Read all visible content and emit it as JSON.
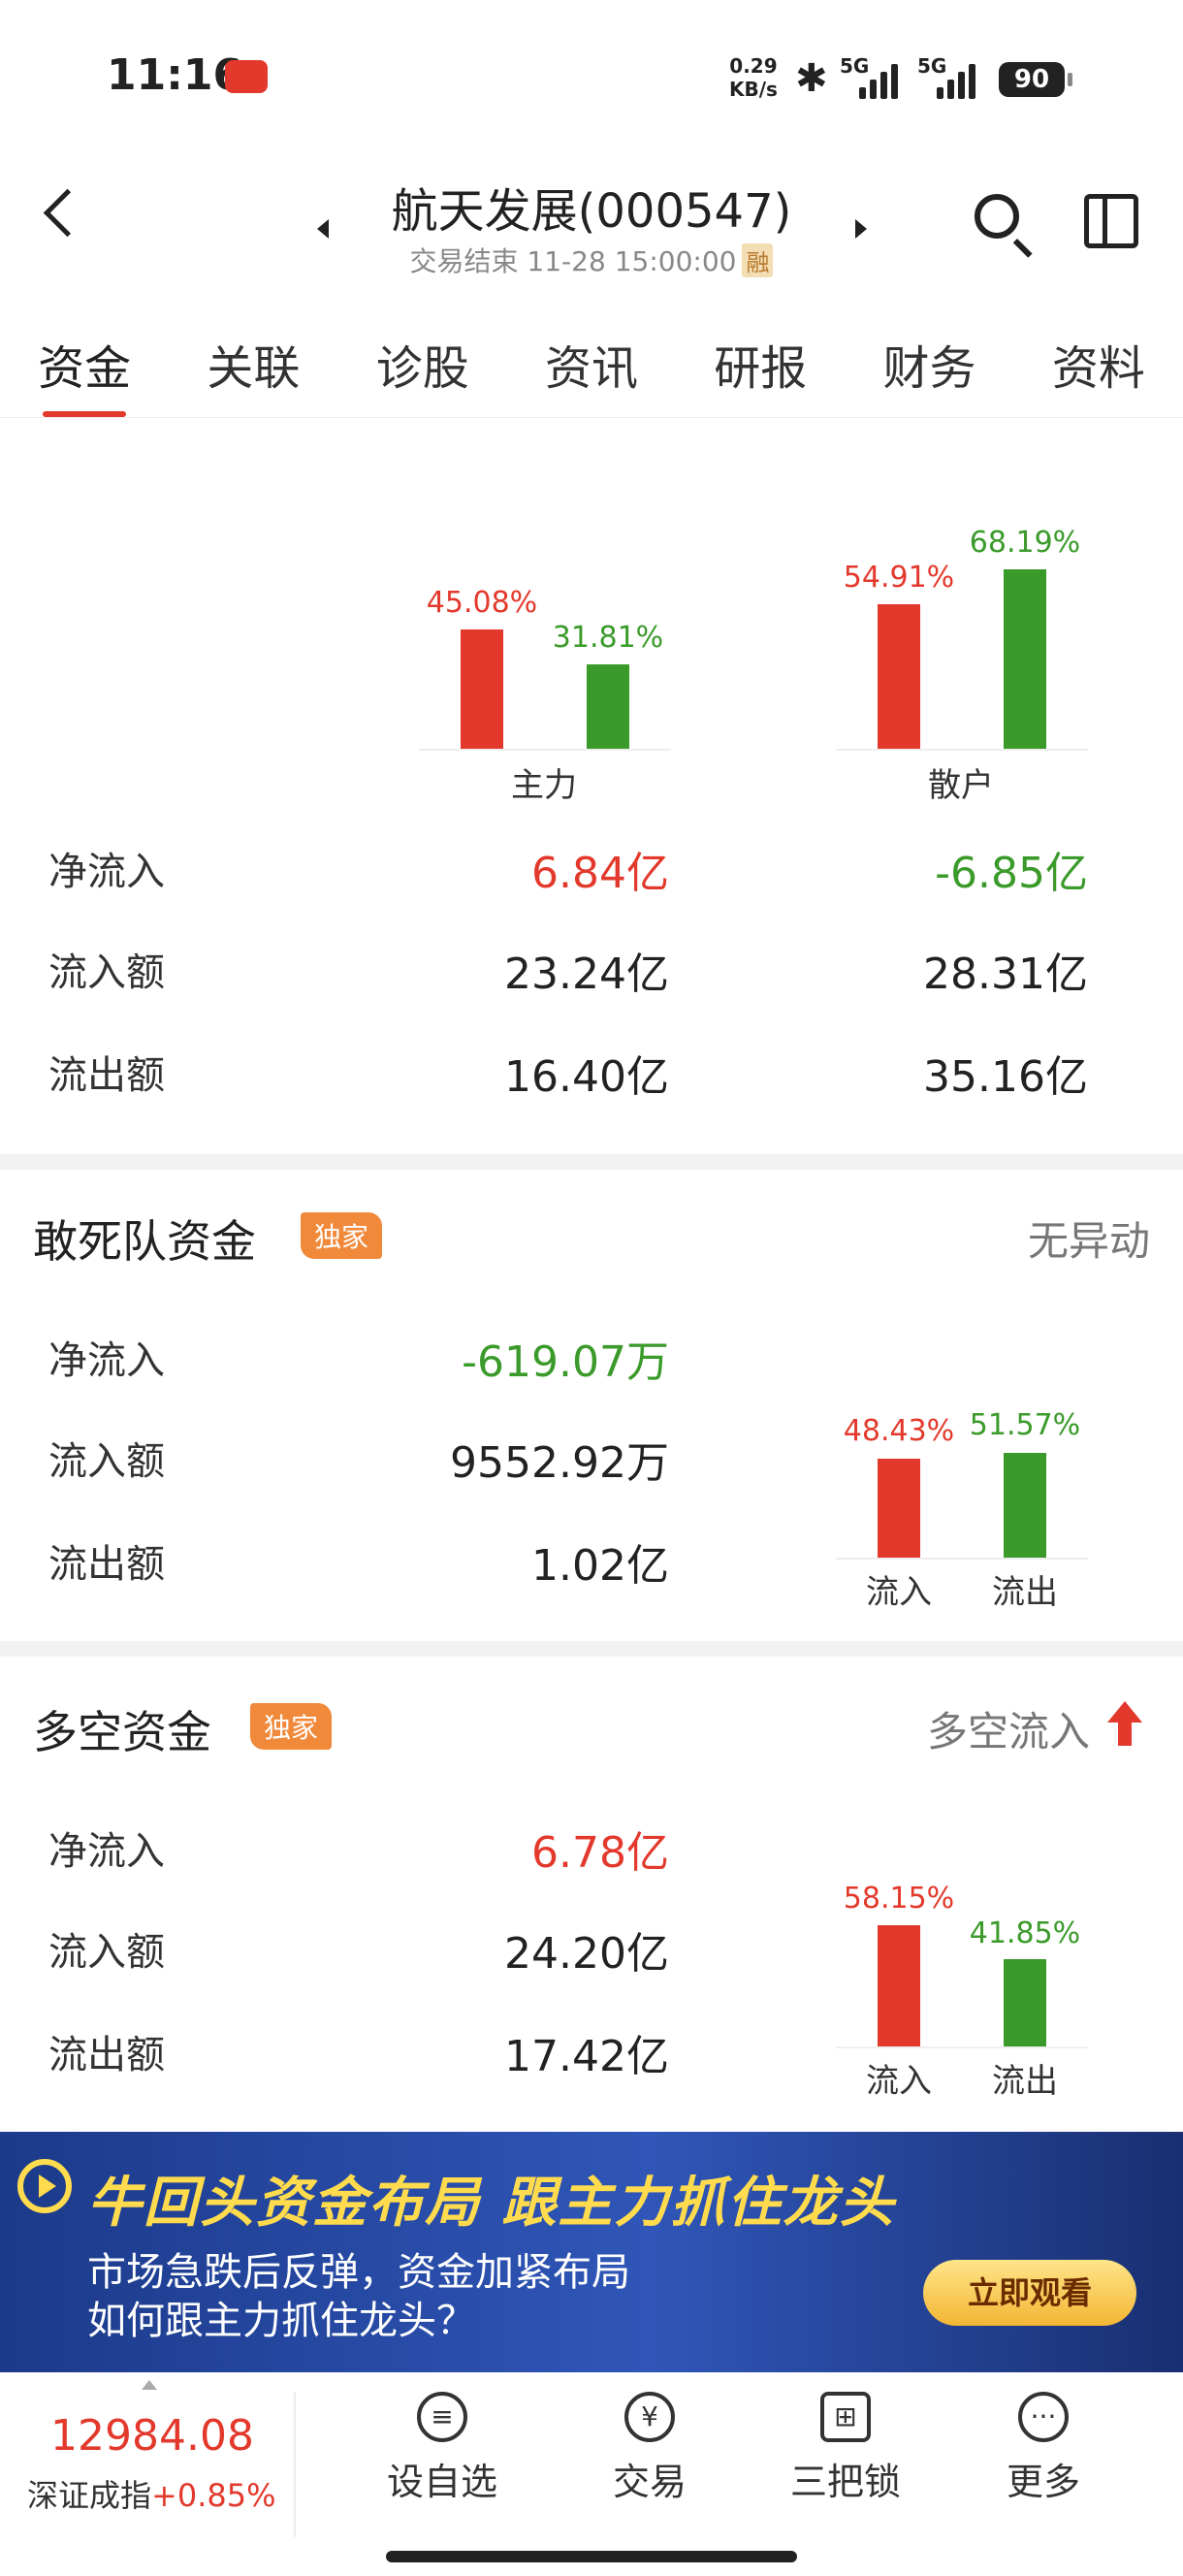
{
  "status_bar": {
    "time": "11:16",
    "net_speed_value": "0.29",
    "net_speed_unit": "KB/s",
    "signal1": "5G",
    "signal2": "5G",
    "battery": "90"
  },
  "header": {
    "title": "航天发展(000547)",
    "subtitle": "交易结束 11-28 15:00:00",
    "rong_badge": "融"
  },
  "tabs": [
    "资金",
    "关联",
    "诊股",
    "资讯",
    "研报",
    "财务",
    "资料"
  ],
  "main_fund": {
    "columns": [
      {
        "label": "主力",
        "inflow_pct": "45.08%",
        "outflow_pct": "31.81%",
        "inflow_ratio": 0.4508,
        "outflow_ratio": 0.3181
      },
      {
        "label": "散户",
        "inflow_pct": "54.91%",
        "outflow_pct": "68.19%",
        "inflow_ratio": 0.5491,
        "outflow_ratio": 0.6819
      }
    ],
    "rows": [
      {
        "label": "净流入",
        "main": "6.84亿",
        "retail": "-6.85亿"
      },
      {
        "label": "流入额",
        "main": "23.24亿",
        "retail": "28.31亿"
      },
      {
        "label": "流出额",
        "main": "16.40亿",
        "retail": "35.16亿"
      }
    ]
  },
  "dare_fund": {
    "title": "敢死队资金",
    "badge": "独家",
    "status": "无异动",
    "rows": [
      {
        "label": "净流入",
        "value": "-619.07万"
      },
      {
        "label": "流入额",
        "value": "9552.92万"
      },
      {
        "label": "流出额",
        "value": "1.02亿"
      }
    ],
    "chart": {
      "inflow_pct": "48.43%",
      "outflow_pct": "51.57%",
      "inflow_ratio": 0.4843,
      "outflow_ratio": 0.5157,
      "inflow_label": "流入",
      "outflow_label": "流出"
    }
  },
  "longshort_fund": {
    "title": "多空资金",
    "badge": "独家",
    "status": "多空流入",
    "rows": [
      {
        "label": "净流入",
        "value": "6.78亿"
      },
      {
        "label": "流入额",
        "value": "24.20亿"
      },
      {
        "label": "流出额",
        "value": "17.42亿"
      }
    ],
    "chart": {
      "inflow_pct": "58.15%",
      "outflow_pct": "41.85%",
      "inflow_ratio": 0.5815,
      "outflow_ratio": 0.4185,
      "inflow_label": "流入",
      "outflow_label": "流出"
    }
  },
  "banner": {
    "headline": "牛回头资金布局  跟主力抓住龙头",
    "line1": "市场急跌后反弹，资金加紧布局",
    "line2": "如何跟主力抓住龙头？",
    "cta": "立即观看"
  },
  "bottom_bar": {
    "index_value": "12984.08",
    "index_name": "深证成指",
    "index_change": "+0.85%",
    "nav": [
      {
        "label": "设自选",
        "icon": "list-icon"
      },
      {
        "label": "交易",
        "icon": "yuan-icon"
      },
      {
        "label": "三把锁",
        "icon": "locks-icon"
      },
      {
        "label": "更多",
        "icon": "more-icon"
      }
    ]
  },
  "colors": {
    "red": "#e3392c",
    "green": "#3a9a2a",
    "badge": "#f0893a"
  }
}
